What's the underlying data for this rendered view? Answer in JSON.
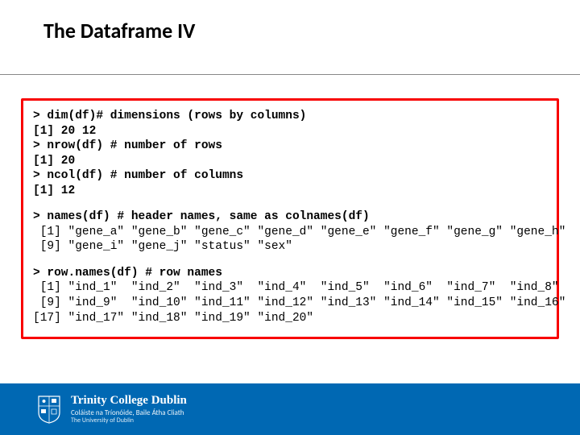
{
  "title": "The Dataframe IV",
  "code": {
    "block1": "> dim(df)# dimensions (rows by columns)\n[1] 20 12\n> nrow(df) # number of rows\n[1] 20\n> ncol(df) # number of columns\n[1] 12",
    "block2_cmd": "> names(df) # header names, same as colnames(df)",
    "block2_out": " [1] \"gene_a\" \"gene_b\" \"gene_c\" \"gene_d\" \"gene_e\" \"gene_f\" \"gene_g\" \"gene_h\"\n [9] \"gene_i\" \"gene_j\" \"status\" \"sex\"",
    "block3_cmd": "> row.names(df) # row names",
    "block3_out": " [1] \"ind_1\"  \"ind_2\"  \"ind_3\"  \"ind_4\"  \"ind_5\"  \"ind_6\"  \"ind_7\"  \"ind_8\"\n [9] \"ind_9\"  \"ind_10\" \"ind_11\" \"ind_12\" \"ind_13\" \"ind_14\" \"ind_15\" \"ind_16\"\n[17] \"ind_17\" \"ind_18\" \"ind_19\" \"ind_20\""
  },
  "footer": {
    "institution": "Trinity College Dublin",
    "sub1": "Coláiste na Tríonóide, Baile Átha Cliath",
    "sub2": "The University of Dublin"
  }
}
